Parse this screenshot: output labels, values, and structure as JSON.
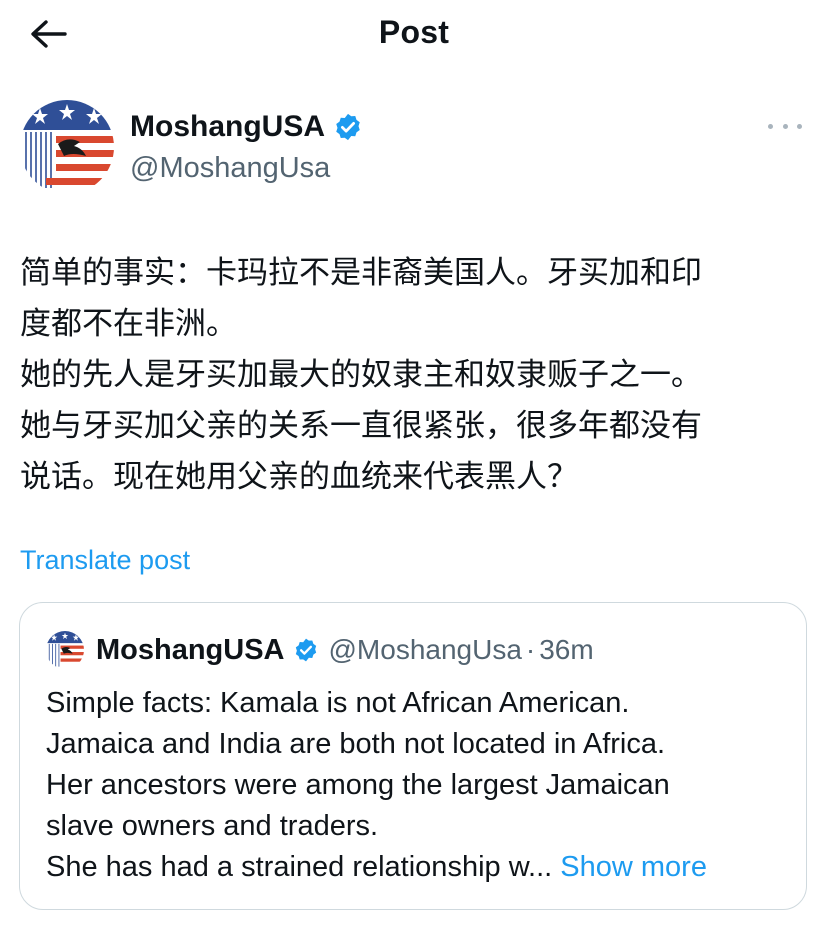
{
  "header": {
    "title": "Post"
  },
  "author": {
    "display_name": "MoshangUSA",
    "handle": "@MoshangUsa"
  },
  "post": {
    "text": "简单的事实：卡玛拉不是非裔美国人。牙买加和印\n度都不在非洲。\n她的先人是牙买加最大的奴隶主和奴隶贩子之一。\n她与牙买加父亲的关系一直很紧张，很多年都没有\n说话。现在她用父亲的血统来代表黑人？",
    "translate_label": "Translate post"
  },
  "quote": {
    "display_name": "MoshangUSA",
    "handle": "@MoshangUsa",
    "separator": "·",
    "time": "36m",
    "lines": [
      "Simple facts: Kamala is not African American.",
      "Jamaica and India are both not located in Africa.",
      "Her ancestors were among the largest Jamaican",
      "slave owners and traders."
    ],
    "last_line": "She has had a strained relationship w...",
    "show_more": "Show more"
  },
  "colors": {
    "accent": "#1d9bf0",
    "muted": "#536471",
    "border": "#cfd9de",
    "flag_red": "#d9482f",
    "flag_blue": "#2f4f97"
  },
  "icons": {
    "back": "arrow-left-icon",
    "verified": "verified-badge-icon",
    "more": "more-dots-icon"
  }
}
